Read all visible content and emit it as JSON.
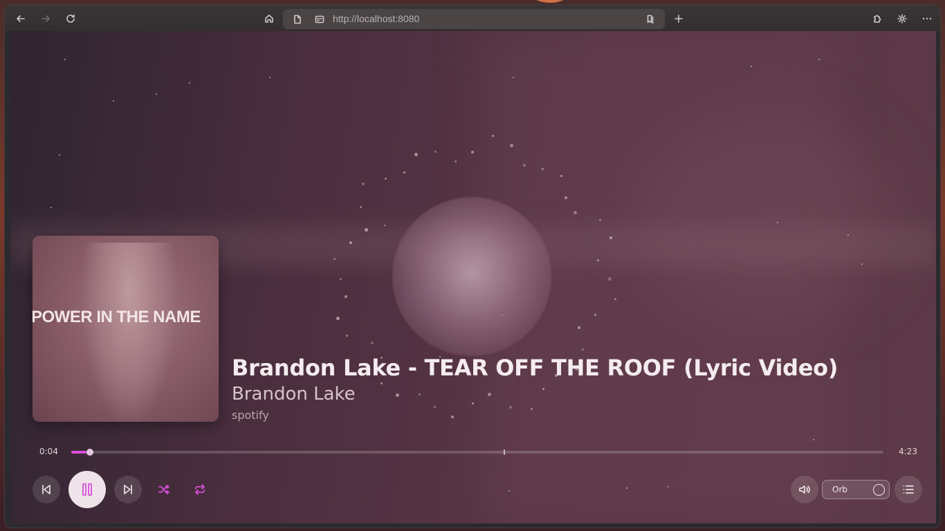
{
  "browser": {
    "url": "http://localhost:8080",
    "icons": {
      "back": "arrow-left-icon",
      "forward": "arrow-right-icon",
      "reload": "reload-icon",
      "home": "home-icon",
      "page": "page-icon",
      "site_info": "site-info-icon",
      "bookmark": "bookmark-icon",
      "new_tab": "plus-icon",
      "extensions": "puzzle-icon",
      "settings": "gear-icon",
      "menu": "more-icon"
    }
  },
  "player": {
    "album_cover_text": "POWER IN THE NAME",
    "track_title": "Brandon Lake - TEAR OFF THE ROOF (Lyric Video)",
    "artist": "Brandon Lake",
    "source": "spotify",
    "elapsed": "0:04",
    "duration": "4:23",
    "progress_fraction": 0.016,
    "visualizer_mode": "Orb",
    "accent_color": "#d94fdc",
    "state": "playing",
    "controls": {
      "previous": "skip-back-icon",
      "play_pause": "pause-icon",
      "next": "skip-forward-icon",
      "shuffle": "shuffle-icon",
      "repeat": "repeat-icon",
      "volume": "volume-icon",
      "queue": "list-icon"
    }
  }
}
